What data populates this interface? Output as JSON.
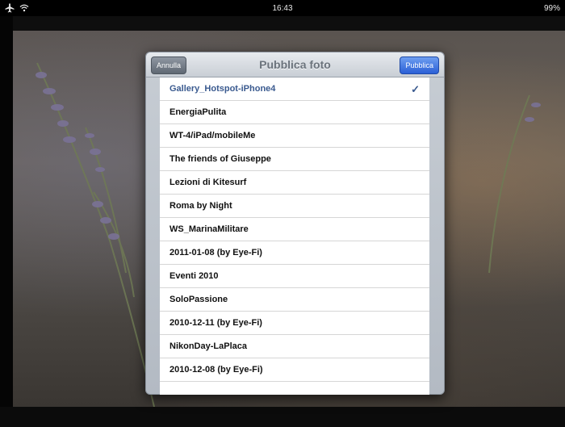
{
  "status_bar": {
    "time": "16:43",
    "battery": "99%",
    "icons": [
      "airplane-icon",
      "wifi-icon"
    ]
  },
  "popover": {
    "title": "Pubblica foto",
    "cancel_label": "Annulla",
    "publish_label": "Pubblica"
  },
  "galleries": [
    {
      "label": "Gallery_Hotspot-iPhone4",
      "selected": true
    },
    {
      "label": "EnergiaPulita",
      "selected": false
    },
    {
      "label": "WT-4/iPad/mobileMe",
      "selected": false
    },
    {
      "label": "The friends of Giuseppe",
      "selected": false
    },
    {
      "label": "Lezioni di Kitesurf",
      "selected": false
    },
    {
      "label": "Roma by Night",
      "selected": false
    },
    {
      "label": "WS_MarinaMilitare",
      "selected": false
    },
    {
      "label": "2011-01-08 (by Eye-Fi)",
      "selected": false
    },
    {
      "label": "Eventi 2010",
      "selected": false
    },
    {
      "label": "SoloPassione",
      "selected": false
    },
    {
      "label": "2010-12-11 (by Eye-Fi)",
      "selected": false
    },
    {
      "label": "NikonDay-LaPlaca",
      "selected": false
    },
    {
      "label": "2010-12-08 (by Eye-Fi)",
      "selected": false
    }
  ],
  "colors": {
    "accent": "#3a5a8f",
    "publish_button": "#2a5fd6"
  }
}
